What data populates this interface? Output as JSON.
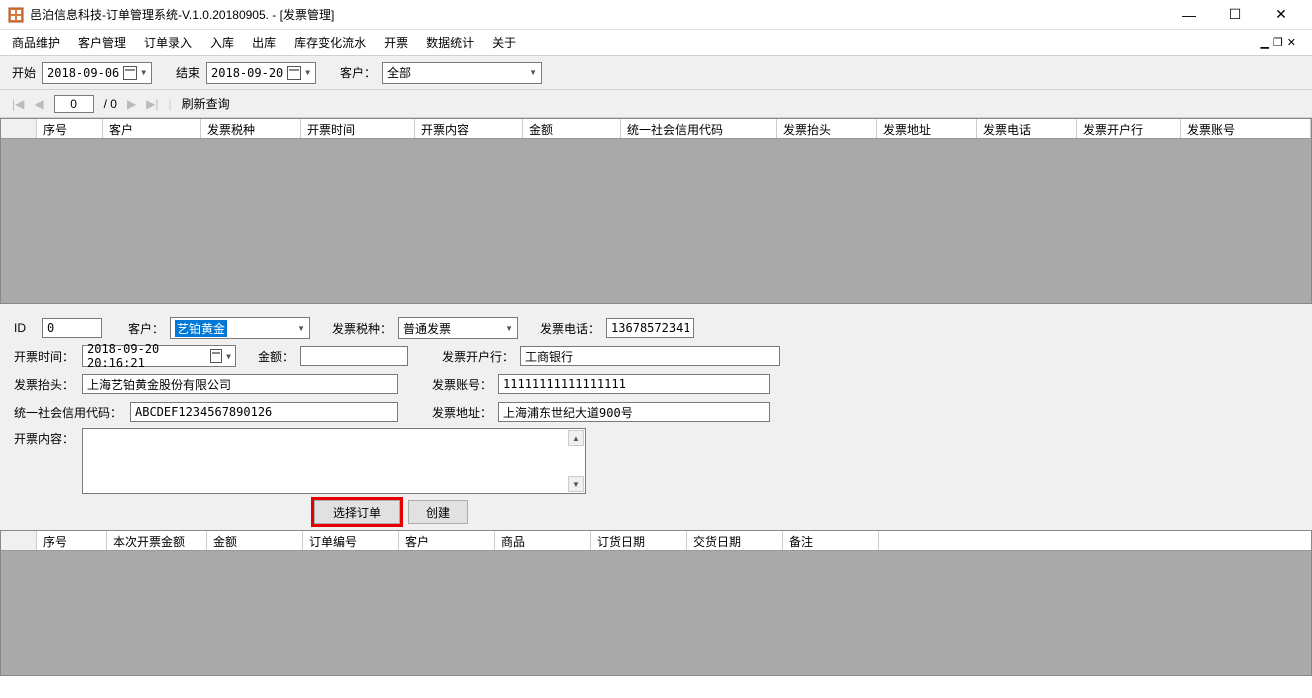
{
  "window": {
    "title": "邑泊信息科技-订单管理系统-V.1.0.20180905. - [发票管理]"
  },
  "menubar": {
    "items": [
      "商品维护",
      "客户管理",
      "订单录入",
      "入库",
      "出库",
      "库存变化流水",
      "开票",
      "数据统计",
      "关于"
    ]
  },
  "toolbar": {
    "start_label": "开始",
    "start_value": "2018-09-06",
    "end_label": "结束",
    "end_value": "2018-09-20",
    "customer_label": "客户：",
    "customer_value": "全部"
  },
  "pager": {
    "current": "0",
    "total": "/ 0",
    "refresh": "刷新查询"
  },
  "grid1_columns": [
    "序号",
    "客户",
    "发票税种",
    "开票时间",
    "开票内容",
    "金额",
    "统一社会信用代码",
    "发票抬头",
    "发票地址",
    "发票电话",
    "发票开户行",
    "发票账号"
  ],
  "form": {
    "id_label": "ID",
    "id_value": "0",
    "customer_label": "客户：",
    "customer_value": "艺铂黄金",
    "taxtype_label": "发票税种：",
    "taxtype_value": "普通发票",
    "phone_label": "发票电话：",
    "phone_value": "13678572341",
    "time_label": "开票时间：",
    "time_value": "2018-09-20 20:16:21",
    "amount_label": "金额：",
    "amount_value": "",
    "bank_label": "发票开户行：",
    "bank_value": "工商银行",
    "title_label": "发票抬头：",
    "title_value": "上海艺铂黄金股份有限公司",
    "account_label": "发票账号：",
    "account_value": "11111111111111111",
    "uscc_label": "统一社会信用代码：",
    "uscc_value": "ABCDEF1234567890126",
    "addr_label": "发票地址：",
    "addr_value": "上海浦东世纪大道900号",
    "content_label": "开票内容：",
    "select_order_btn": "选择订单",
    "create_btn": "创建"
  },
  "grid2_columns": [
    "序号",
    "本次开票金额",
    "金额",
    "订单编号",
    "客户",
    "商品",
    "订货日期",
    "交货日期",
    "备注"
  ]
}
